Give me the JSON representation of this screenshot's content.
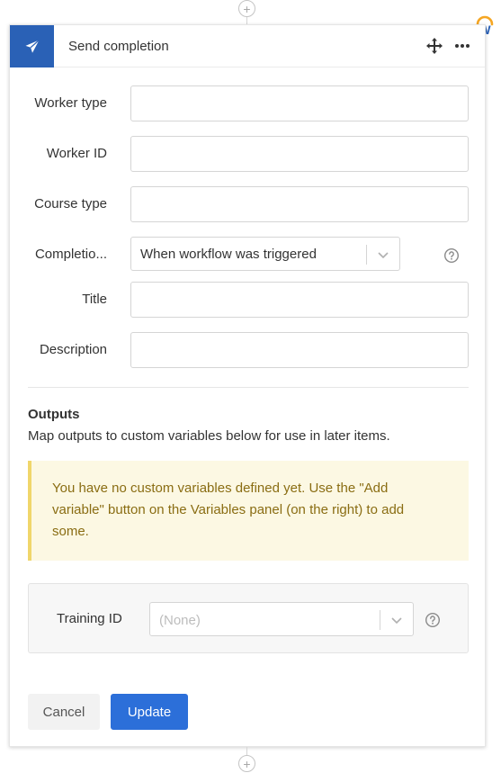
{
  "connectors": {
    "add_top_symbol": "+",
    "add_bottom_symbol": "+"
  },
  "brand": {
    "logo_letter": "W",
    "logo_arc_color": "#f5a623",
    "logo_letter_color": "#2a61b6"
  },
  "step": {
    "title": "Send completion",
    "icon": "paper-plane-icon",
    "accent_color": "#2a61b6",
    "actions": [
      "move-icon",
      "more-icon"
    ]
  },
  "fields": [
    {
      "label": "Worker type",
      "value": ""
    },
    {
      "label": "Worker ID",
      "value": ""
    },
    {
      "label": "Course type",
      "value": ""
    },
    {
      "label": "Completio...",
      "type": "select",
      "selected": "When workflow was triggered",
      "help_icon": "question-circle-icon"
    },
    {
      "label": "Title",
      "value": ""
    },
    {
      "label": "Description",
      "value": ""
    }
  ],
  "outputs": {
    "title": "Outputs",
    "description": "Map outputs to custom variables below for use in later items.",
    "warning": "You have no custom variables defined yet. Use the \"Add variable\" button on the Variables panel (on the right) to add some.",
    "warning_color": "#8a6d13",
    "mapping": {
      "label": "Training ID",
      "placeholder": "(None)",
      "help_icon": "question-circle-icon"
    }
  },
  "buttons": {
    "cancel": "Cancel",
    "update": "Update",
    "update_color": "#2c6fd9"
  }
}
